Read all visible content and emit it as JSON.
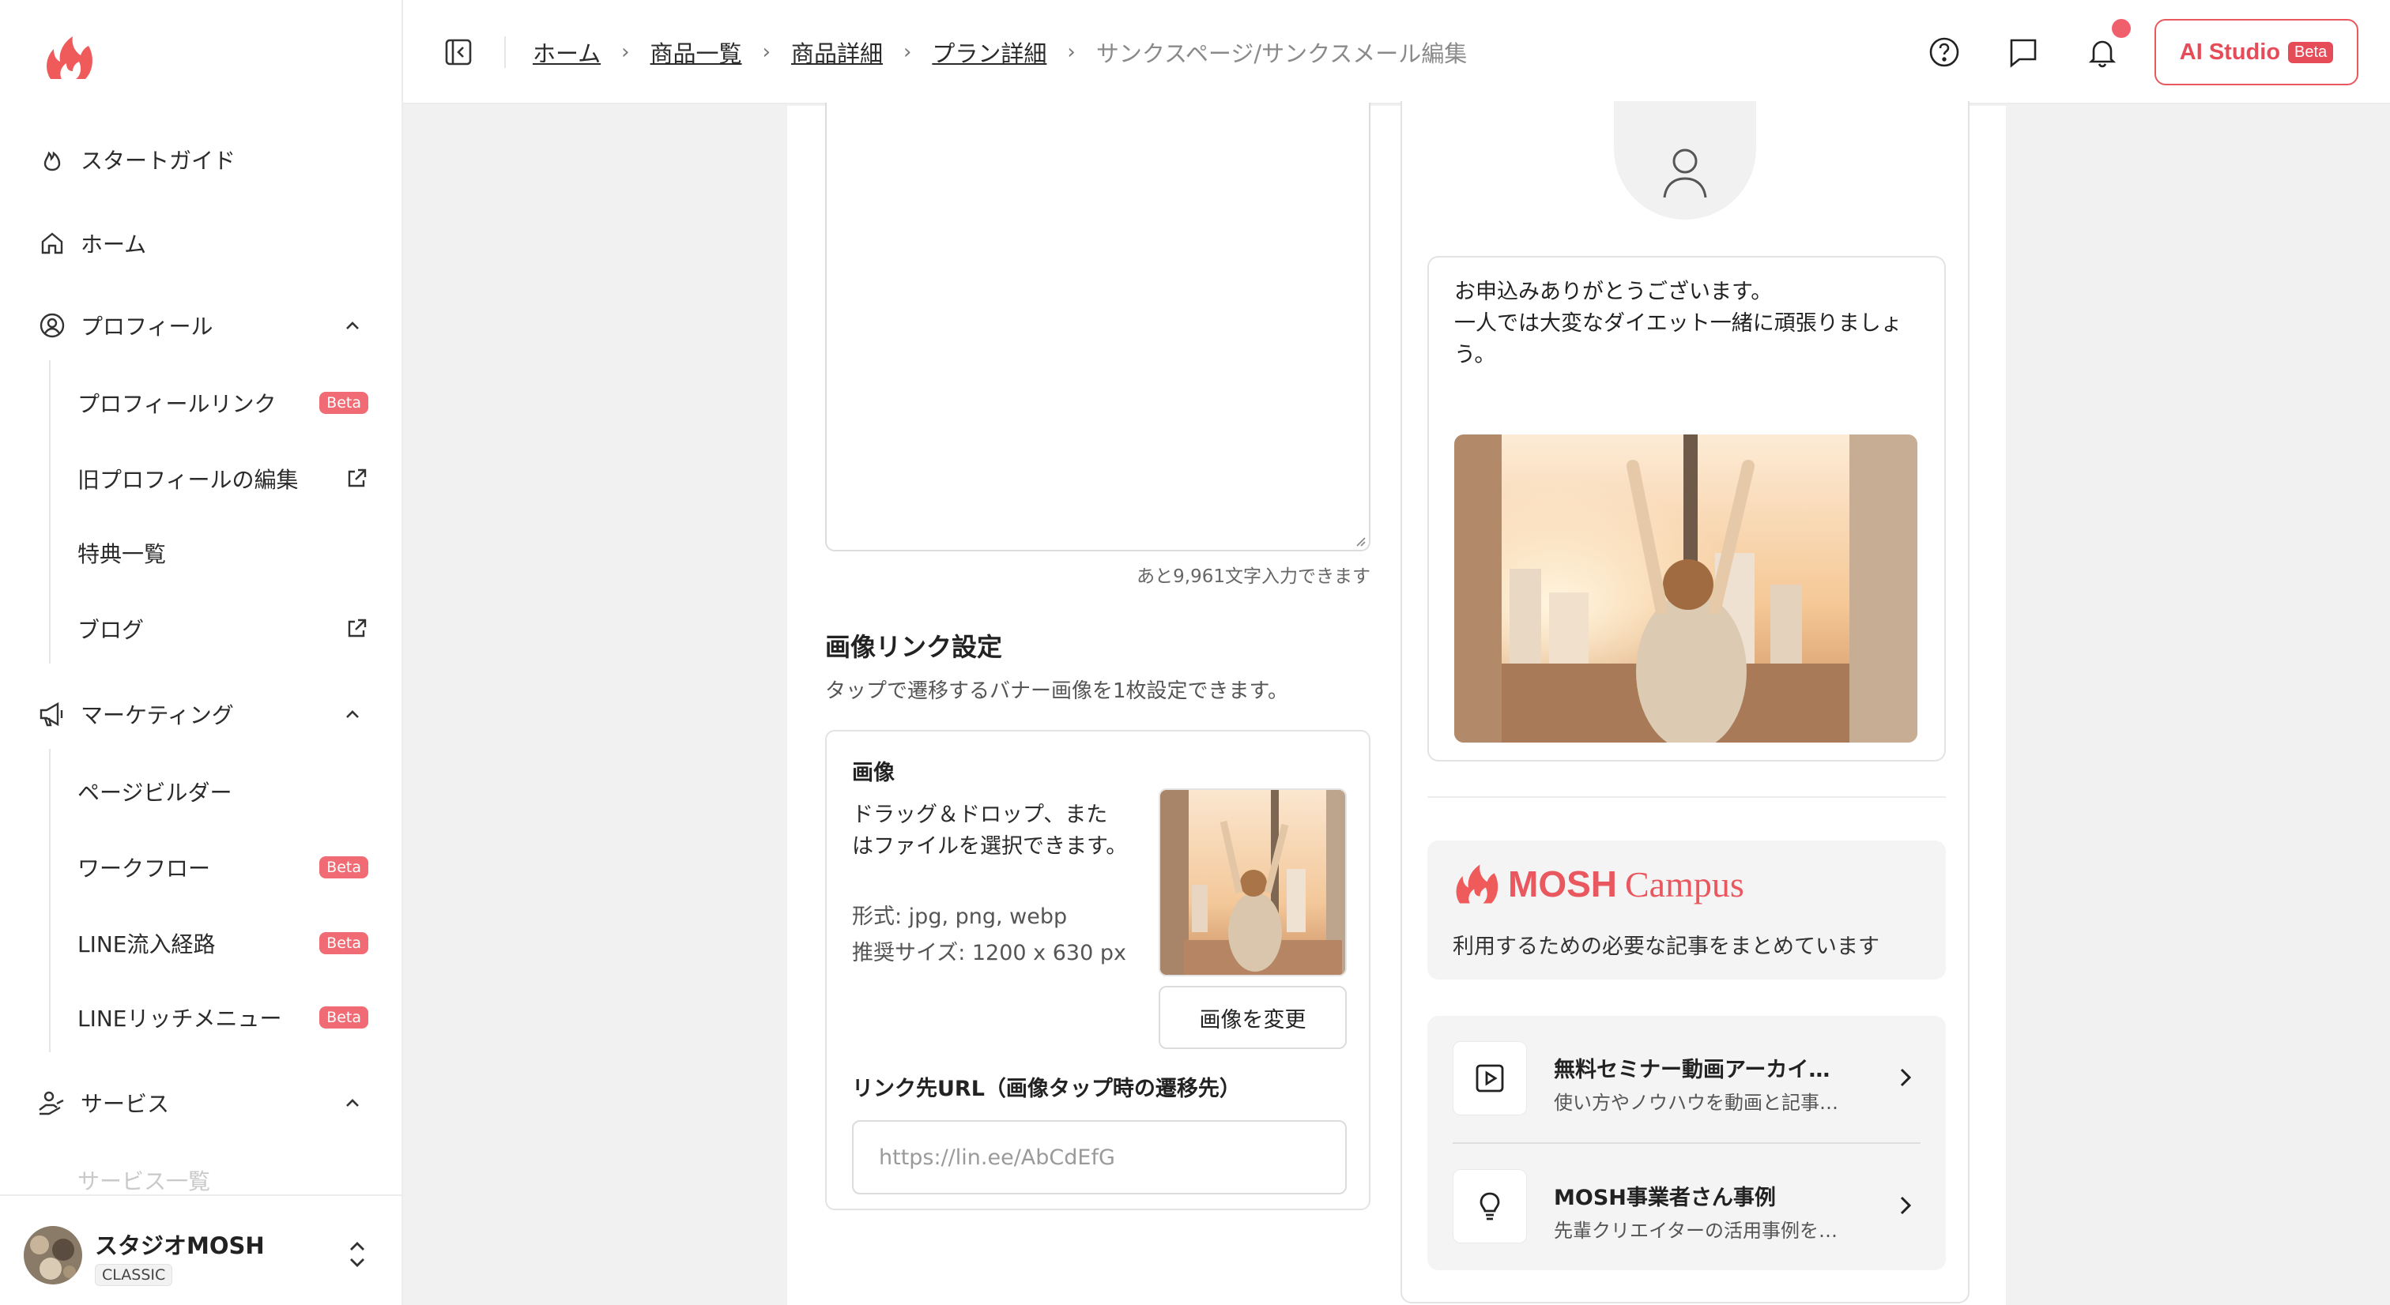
{
  "app": {
    "brand_color": "#e9585f"
  },
  "sidebar": {
    "items": [
      {
        "label": "スタートガイド",
        "icon": "flame-icon"
      },
      {
        "label": "ホーム",
        "icon": "home-icon"
      },
      {
        "label": "プロフィール",
        "icon": "profile-icon"
      },
      {
        "label": "マーケティング",
        "icon": "megaphone-icon"
      },
      {
        "label": "サービス",
        "icon": "service-icon"
      }
    ],
    "profile_sub": [
      {
        "label": "プロフィールリンク",
        "badge": "Beta"
      },
      {
        "label": "旧プロフィールの編集"
      },
      {
        "label": "特典一覧"
      },
      {
        "label": "ブログ"
      }
    ],
    "marketing_sub": [
      {
        "label": "ページビルダー"
      },
      {
        "label": "ワークフロー",
        "badge": "Beta"
      },
      {
        "label": "LINE流入経路",
        "badge": "Beta"
      },
      {
        "label": "LINEリッチメニュー",
        "badge": "Beta"
      }
    ],
    "service_sub": [
      {
        "label": "サービス一覧"
      }
    ],
    "account": {
      "name": "スタジオMOSH",
      "plan": "CLASSIC"
    }
  },
  "topbar": {
    "breadcrumb": [
      "ホーム",
      "商品一覧",
      "商品詳細",
      "プラン詳細"
    ],
    "current": "サンクスページ/サンクスメール編集",
    "ai_label": "AI Studio",
    "ai_badge": "Beta"
  },
  "editor": {
    "char_count": "あと9,961文字入力できます",
    "image_link": {
      "title": "画像リンク設定",
      "desc": "タップで遷移するバナー画像を1枚設定できます。",
      "image_label": "画像",
      "drop_text": "ドラッグ＆ドロップ、またはファイルを選択できます。",
      "format": "形式: jpg, png, webp",
      "size": "推奨サイズ: 1200 x 630 px",
      "change_button": "画像を変更",
      "url_label": "リンク先URL（画像タップ時の遷移先）",
      "url_placeholder": "https://lin.ee/AbCdEfG"
    }
  },
  "preview": {
    "message": "お申込みありがとうございます。\n一人では大変なダイエット一緒に頑張りましょう。",
    "campus": {
      "brand": "MOSH",
      "word": "Campus",
      "subtitle": "利用するための必要な記事をまとめています"
    },
    "links": [
      {
        "title": "無料セミナー動画アーカイ…",
        "sub": "使い方やノウハウを動画と記事…",
        "icon": "play-icon"
      },
      {
        "title": "MOSH事業者さん事例",
        "sub": "先輩クリエイターの活用事例を…",
        "icon": "lightbulb-icon"
      }
    ]
  }
}
